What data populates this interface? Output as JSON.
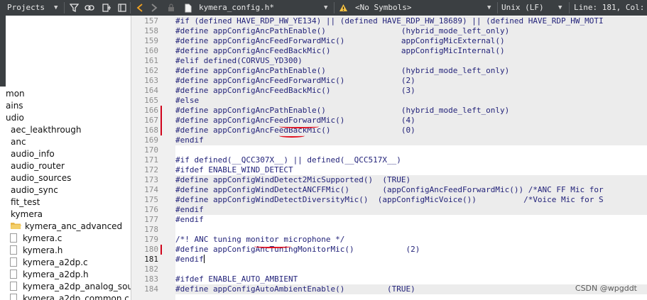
{
  "toolbar": {
    "panel_title": "Projects",
    "file_name": "kymera_config.h*",
    "symbols_dropdown": "<No Symbols>",
    "line_ending": "Unix (LF)",
    "position": "Line: 181, Col:"
  },
  "tree": [
    {
      "label": "mon",
      "kind": "folder-partial"
    },
    {
      "label": "ains",
      "kind": "folder-partial"
    },
    {
      "label": "udio",
      "kind": "folder-partial"
    },
    {
      "label": "aec_leakthrough",
      "kind": "folder"
    },
    {
      "label": "anc",
      "kind": "folder"
    },
    {
      "label": "audio_info",
      "kind": "folder"
    },
    {
      "label": "audio_router",
      "kind": "folder"
    },
    {
      "label": "audio_sources",
      "kind": "folder"
    },
    {
      "label": "audio_sync",
      "kind": "folder"
    },
    {
      "label": "fit_test",
      "kind": "folder"
    },
    {
      "label": "kymera",
      "kind": "folder"
    },
    {
      "label": "kymera_anc_advanced",
      "kind": "folder-open"
    },
    {
      "label": "kymera.c",
      "kind": "file"
    },
    {
      "label": "kymera.h",
      "kind": "file"
    },
    {
      "label": "kymera_a2dp.c",
      "kind": "file"
    },
    {
      "label": "kymera_a2dp.h",
      "kind": "file"
    },
    {
      "label": "kymera_a2dp_analog_sou",
      "kind": "file"
    },
    {
      "label": "kymera_a2dp_common.c",
      "kind": "file"
    }
  ],
  "code_lines": [
    {
      "n": "157",
      "text": "#if (defined HAVE_RDP_HW_YE134) || (defined HAVE_RDP_HW_18689) || (defined HAVE_RDP_HW_MOTI",
      "shade": true,
      "mod": false
    },
    {
      "n": "158",
      "text": "#define appConfigAncPathEnable()                (hybrid_mode_left_only)",
      "shade": true,
      "mod": false
    },
    {
      "n": "159",
      "text": "#define appConfigAncFeedForwardMic()            appConfigMicExternal()",
      "shade": true,
      "mod": false
    },
    {
      "n": "160",
      "text": "#define appConfigAncFeedBackMic()               appConfigMicInternal()",
      "shade": true,
      "mod": false
    },
    {
      "n": "161",
      "text": "#elif defined(CORVUS_YD300)",
      "shade": true,
      "mod": false
    },
    {
      "n": "162",
      "text": "#define appConfigAncPathEnable()                (hybrid_mode_left_only)",
      "shade": true,
      "mod": false
    },
    {
      "n": "163",
      "text": "#define appConfigAncFeedForwardMic()            (2)",
      "shade": true,
      "mod": false
    },
    {
      "n": "164",
      "text": "#define appConfigAncFeedBackMic()               (3)",
      "shade": true,
      "mod": false
    },
    {
      "n": "165",
      "text": "#else",
      "shade": true,
      "mod": false
    },
    {
      "n": "166",
      "text": "#define appConfigAncPathEnable()                (hybrid_mode_left_only)",
      "shade": true,
      "mod": true
    },
    {
      "n": "167",
      "text": "#define appConfigAncFeedForwardMic()            (4)",
      "shade": true,
      "mod": true
    },
    {
      "n": "168",
      "text": "#define appConfigAncFeedBackMic()               (0)",
      "shade": true,
      "mod": true
    },
    {
      "n": "169",
      "text": "#endif",
      "shade": true,
      "mod": false
    },
    {
      "n": "170",
      "text": "",
      "shade": false,
      "mod": false
    },
    {
      "n": "171",
      "text": "#if defined(__QCC307X__) || defined(__QCC517X__)",
      "shade": false,
      "mod": false
    },
    {
      "n": "172",
      "text": "#ifdef ENABLE_WIND_DETECT",
      "shade": false,
      "mod": false
    },
    {
      "n": "173",
      "text": "#define appConfigWindDetect2MicSupported()  (TRUE)",
      "shade": true,
      "mod": false
    },
    {
      "n": "174",
      "text": "#define appConfigWindDetectANCFFMic()       (appConfigAncFeedForwardMic()) /*ANC FF Mic for",
      "shade": true,
      "mod": false
    },
    {
      "n": "175",
      "text": "#define appConfigWindDetectDiversityMic()  (appConfigMicVoice())          /*Voice Mic for S",
      "shade": true,
      "mod": false
    },
    {
      "n": "176",
      "text": "#endif",
      "shade": true,
      "mod": false
    },
    {
      "n": "177",
      "text": "#endif",
      "shade": false,
      "mod": false
    },
    {
      "n": "178",
      "text": "",
      "shade": false,
      "mod": false
    },
    {
      "n": "179",
      "text": "/*! ANC tuning monitor microphone */",
      "shade": false,
      "mod": false
    },
    {
      "n": "180",
      "text": "#define appConfigAncTuningMonitorMic()           (2)",
      "shade": false,
      "mod": true
    },
    {
      "n": "181",
      "text": "#endif",
      "shade": false,
      "mod": false,
      "current": true
    },
    {
      "n": "182",
      "text": "",
      "shade": false,
      "mod": false
    },
    {
      "n": "183",
      "text": "#ifdef ENABLE_AUTO_AMBIENT",
      "shade": false,
      "mod": false
    },
    {
      "n": "184",
      "text": "#define appConfigAutoAmbientEnable()         (TRUE)",
      "shade": true,
      "mod": false
    }
  ],
  "watermark": "CSDN @wpgddt",
  "colors": {
    "toolbar_bg": "#3b3f42",
    "code_text": "#23237a",
    "annotation_red": "#e3101e",
    "shade": "#ececec"
  }
}
